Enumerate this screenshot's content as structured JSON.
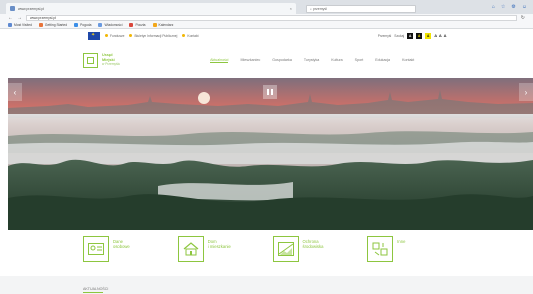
{
  "browser": {
    "tab_title": "www.przemysl.pl",
    "search_placeholder": "przemyśl",
    "url": "www.przemysl.pl",
    "window_buttons": [
      "⌂",
      "☆",
      "⚙",
      "☺"
    ]
  },
  "bookmarks": [
    {
      "label": "Most Visited",
      "color": "#5f8ad1"
    },
    {
      "label": "Getting Started",
      "color": "#e8743b"
    },
    {
      "label": "Pogoda",
      "color": "#3b8ee8"
    },
    {
      "label": "Wiadomości",
      "color": "#6a9ae0"
    },
    {
      "label": "Poczta",
      "color": "#d9473c"
    },
    {
      "label": "Kalendarz",
      "color": "#f2a71b"
    }
  ],
  "top_strip": {
    "items": [
      "Fundusze",
      "Biuletyn Informacji Publicznej",
      "Kontakt"
    ],
    "right_items": [
      "Przemyśl",
      "Szukaj"
    ],
    "contrast_labels": [
      "A",
      "A",
      "A"
    ],
    "font_sizer": "A A A"
  },
  "header": {
    "logo_lines": [
      "Urząd",
      "Miejski",
      "w Przemyślu"
    ],
    "menu": [
      "Aktualności",
      "Mieszkaniec",
      "Gospodarka",
      "Turystyka",
      "Kultura",
      "Sport",
      "Edukacja",
      "Kontakt"
    ],
    "active_index": 0
  },
  "hero": {
    "arrows": [
      "‹",
      "›"
    ],
    "sky_color": "#c9706a",
    "fog_color": "#d7dad9"
  },
  "tiles": [
    {
      "label_lines": [
        "Dane",
        "osobowe"
      ],
      "icon": "id-card-icon"
    },
    {
      "label_lines": [
        "Dom",
        "i mieszkanie"
      ],
      "icon": "house-icon"
    },
    {
      "label_lines": [
        "Ochrona",
        "środowiska"
      ],
      "icon": "landscape-icon"
    },
    {
      "label_lines": [
        "Inne"
      ],
      "icon": "tools-icon"
    }
  ],
  "section": {
    "label": "AKTUALNOŚCI"
  },
  "colors": {
    "accent": "#8dc63f",
    "eu_blue": "#1f48a8"
  }
}
